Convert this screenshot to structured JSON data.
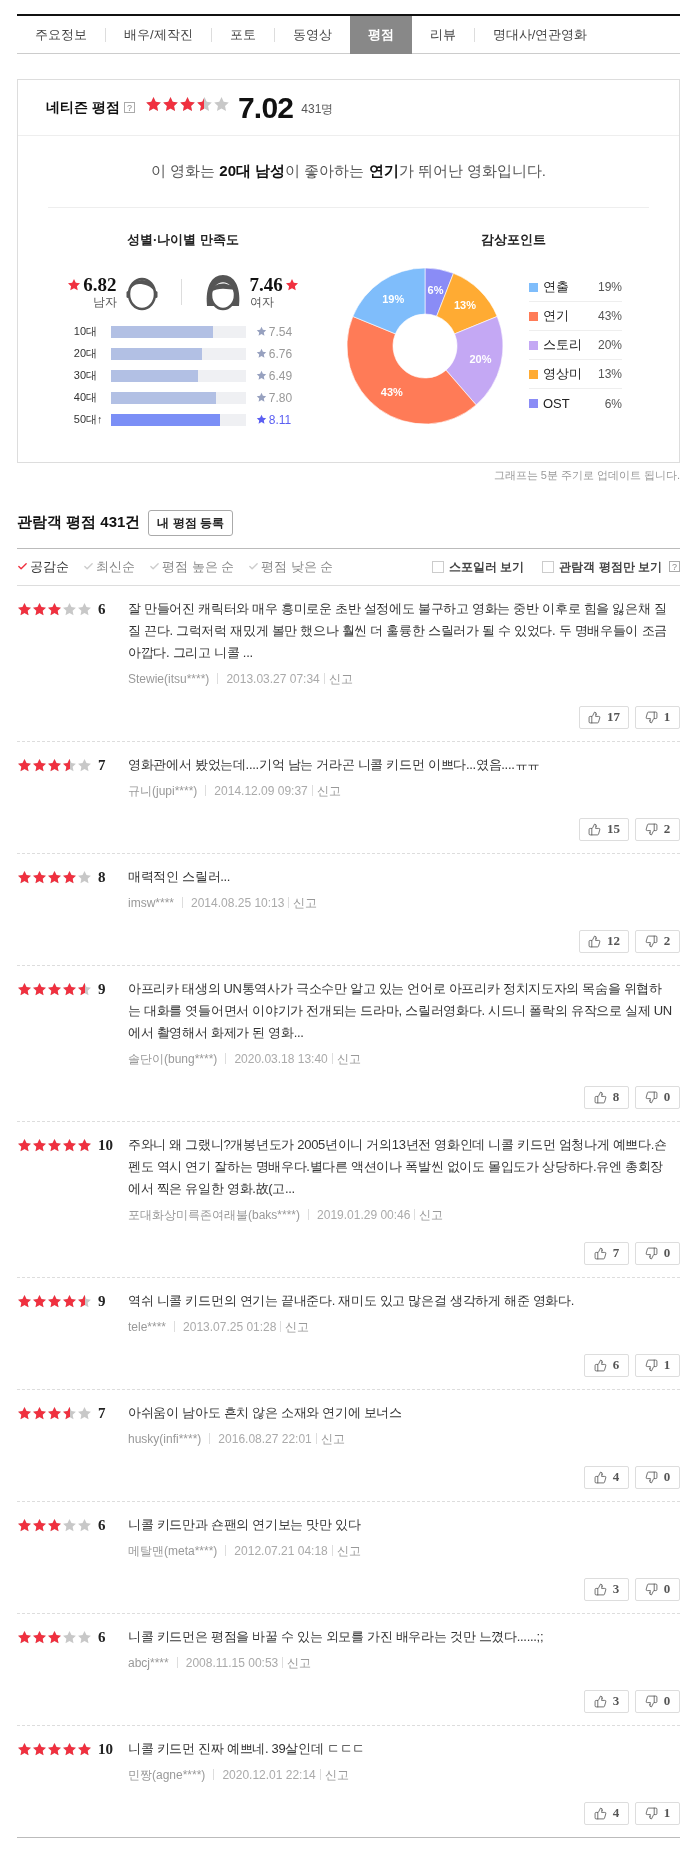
{
  "tabs": [
    {
      "label": "주요정보",
      "selected": false
    },
    {
      "label": "배우/제작진",
      "selected": false
    },
    {
      "label": "포토",
      "selected": false
    },
    {
      "label": "동영상",
      "selected": false
    },
    {
      "label": "평점",
      "selected": true
    },
    {
      "label": "리뷰",
      "selected": false
    },
    {
      "label": "명대사/연관영화",
      "selected": false
    }
  ],
  "netizen": {
    "title": "네티즌 평점",
    "help": "?",
    "stars": 3.5,
    "score": "7.02",
    "count": "431명",
    "summary": "이 영화는 **20대 남성**이 좋아하는 **연기**가 뛰어난 영화입니다.",
    "satisfaction": {
      "title": "성별·나이별 만족도",
      "genders": [
        {
          "kind": "male",
          "score": "6.82",
          "label": "남자"
        },
        {
          "kind": "female",
          "score": "7.46",
          "label": "여자"
        }
      ],
      "ages": [
        {
          "label": "10대",
          "level": 0.754,
          "score": "7.54",
          "top": false
        },
        {
          "label": "20대",
          "level": 0.676,
          "score": "6.76",
          "top": false
        },
        {
          "label": "30대",
          "level": 0.649,
          "score": "6.49",
          "top": false
        },
        {
          "label": "40대",
          "level": 0.78,
          "score": "7.80",
          "top": false
        },
        {
          "label": "50대↑",
          "level": 0.811,
          "score": "8.11",
          "top": true
        }
      ]
    },
    "points": {
      "title": "감상포인트",
      "chart_data": {
        "type": "donut",
        "categories": [
          "연출",
          "연기",
          "스토리",
          "영상미",
          "OST"
        ],
        "values": [
          19,
          43,
          20,
          13,
          6
        ],
        "value_labels": [
          "19%",
          "43%",
          "20%",
          "13%",
          "6%"
        ]
      },
      "legend": [
        {
          "value": "19%",
          "color": "#7fbdfb"
        },
        {
          "value": "43%",
          "color": "#ff7b57"
        },
        {
          "value": "20%",
          "color": "#c4a8f4"
        },
        {
          "value": "13%",
          "color": "#ffab33"
        },
        {
          "value": "6%",
          "color": "#8a8cf6"
        }
      ]
    },
    "note": "그래프는 5분 주기로 업데이트 됩니다."
  },
  "audience": {
    "title": "관람객 평점 ",
    "count": "431",
    "unit": "건",
    "write_button": "내 평점 등록",
    "sort": [
      {
        "label": "공감순",
        "selected": true
      },
      {
        "label": "최신순",
        "selected": false
      },
      {
        "label": "평점 높은 순",
        "selected": false
      },
      {
        "label": "평점 낮은 순",
        "selected": false
      }
    ],
    "filters": [
      {
        "label": "스포일러 보기",
        "checked": false
      },
      {
        "label": "관람객 평점만 보기",
        "checked": false
      }
    ],
    "filter_help": "?"
  },
  "reviews": [
    {
      "stars": 3,
      "score": "6",
      "text": "잘 만들어진 캐릭터와 매우 흥미로운 초반 설정에도 불구하고 영화는 중반 이후로 힘을 잃은채 질질 끈다. 그럭저럭 재밌게 볼만 했으나 훨씬 더 훌륭한 스릴러가 될 수 있었다. 두 명배우들이 조금 아깝다. 그리고 니콜 ...",
      "author": "Stewie(itsu****)",
      "date": "2013.03.27 07:34",
      "report": "신고",
      "likes": "17",
      "dislikes": "1"
    },
    {
      "stars": 3.5,
      "score": "7",
      "text": "영화관에서 봤었는데....기억 남는 거라곤 니콜 키드먼 이쁘다...였음....ㅠㅠ",
      "author": "규니(jupi****)",
      "date": "2014.12.09 09:37",
      "report": "신고",
      "likes": "15",
      "dislikes": "2"
    },
    {
      "stars": 4,
      "score": "8",
      "text": "매력적인 스릴러...",
      "author": "imsw****",
      "date": "2014.08.25 10:13",
      "report": "신고",
      "likes": "12",
      "dislikes": "2"
    },
    {
      "stars": 4.5,
      "score": "9",
      "text": "아프리카 태생의 UN통역사가 극소수만 알고 있는 언어로 아프리카 정치지도자의 목숨을 위협하는 대화를 엿들어면서 이야기가 전개되는 드라마, 스릴러영화다. 시드니 폴락의 유작으로 실제 UN에서 촬영해서 화제가 된 영화...",
      "author": "솔단이(bung****)",
      "date": "2020.03.18 13:40",
      "report": "신고",
      "likes": "8",
      "dislikes": "0"
    },
    {
      "stars": 5,
      "score": "10",
      "text": "주와니 왜 그랬니?개봉년도가 2005년이니 거의13년전 영화인데 니콜 키드먼 엄청나게 예쁘다.숀펜도 역시 연기 잘하는 명배우다.별다른 액션이나 폭발씬 없이도 몰입도가 상당하다.유엔 총회장에서 찍은 유일한 영화.故(고...",
      "author": "포대화상미륵존여래불(baks****)",
      "date": "2019.01.29 00:46",
      "report": "신고",
      "likes": "7",
      "dislikes": "0"
    },
    {
      "stars": 4.5,
      "score": "9",
      "text": "역쉬 니콜 키드먼의 연기는 끝내준다. 재미도 있고 많은걸 생각하게 해준 영화다.",
      "author": "tele****",
      "date": "2013.07.25 01:28",
      "report": "신고",
      "likes": "6",
      "dislikes": "1"
    },
    {
      "stars": 3.5,
      "score": "7",
      "text": "아쉬움이 남아도 흔치 않은 소재와 연기에 보너스",
      "author": "husky(infi****)",
      "date": "2016.08.27 22:01",
      "report": "신고",
      "likes": "4",
      "dislikes": "0"
    },
    {
      "stars": 3,
      "score": "6",
      "text": "니콜 키드만과 숀팬의 연기보는 맛만 있다",
      "author": "메탈맨(meta****)",
      "date": "2012.07.21 04:18",
      "report": "신고",
      "likes": "3",
      "dislikes": "0"
    },
    {
      "stars": 3,
      "score": "6",
      "text": "니콜 키드먼은 평점을 바꿀 수 있는 외모를 가진 배우라는 것만 느꼈다......;;",
      "author": "abcj****",
      "date": "2008.11.15 00:53",
      "report": "신고",
      "likes": "3",
      "dislikes": "0"
    },
    {
      "stars": 5,
      "score": "10",
      "text": "니콜 키드먼 진짜 예쁘네. 39살인데 ㄷㄷㄷ",
      "author": "민짱(agne****)",
      "date": "2020.12.01 22:14",
      "report": "신고",
      "likes": "4",
      "dislikes": "1"
    }
  ]
}
